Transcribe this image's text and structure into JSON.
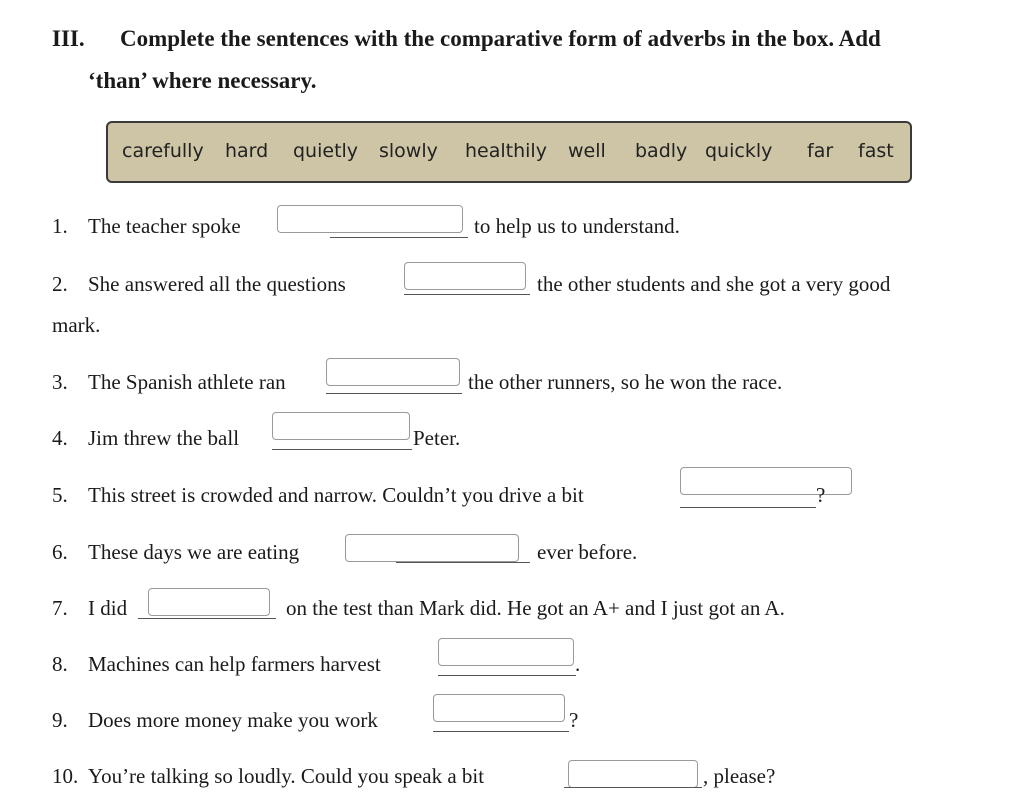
{
  "exercise": {
    "number": "III.",
    "instruction_line1": "Complete the sentences with the comparative form of adverbs in the box. Add",
    "instruction_line2": "‘than’ where necessary."
  },
  "word_box": {
    "words": [
      "carefully",
      "hard",
      "quietly",
      "slowly",
      "healthily",
      "well",
      "badly",
      "quickly",
      "far",
      "fast"
    ]
  },
  "sentences": [
    {
      "num": "1.",
      "before": "The teacher spoke",
      "after": "to help us to understand."
    },
    {
      "num": "2.",
      "before": "She answered all the questions",
      "after": "the other students and she got a very good",
      "continuation": "mark."
    },
    {
      "num": "3.",
      "before": "The Spanish athlete ran",
      "after": "the other runners, so he won the race."
    },
    {
      "num": "4.",
      "before": "Jim threw the ball",
      "after": "Peter."
    },
    {
      "num": "5.",
      "before": "This street is crowded and narrow. Couldn’t you drive a bit",
      "after": "?"
    },
    {
      "num": "6.",
      "before": "These days we are eating",
      "after": "ever before."
    },
    {
      "num": "7.",
      "before": "I did",
      "after": "on the test than Mark did. He got an A+ and I just got an A."
    },
    {
      "num": "8.",
      "before": "Machines can help farmers harvest",
      "after": "."
    },
    {
      "num": "9.",
      "before": "Does more money make you work",
      "after": "?"
    },
    {
      "num": "10.",
      "before": "You’re talking so loudly. Could you speak a bit",
      "after": ", please?"
    }
  ],
  "colors": {
    "word_box_fill": "#cdc5a5",
    "word_box_border": "#3a3a3a",
    "blank_border": "#9a9a9a"
  }
}
